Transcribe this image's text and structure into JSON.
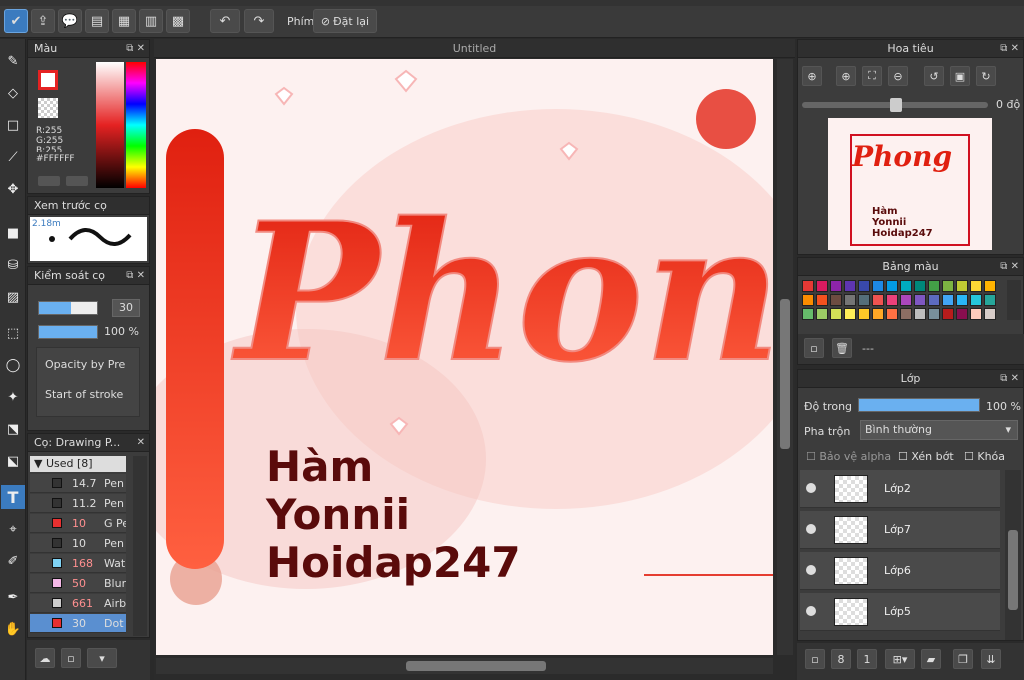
{
  "toolbar": {
    "keys_label": "Phím",
    "reset_label": "Đặt lại"
  },
  "color_panel": {
    "title": "Màu",
    "r": "R:255",
    "g": "G:255",
    "b": "B:255",
    "hex": "#FFFFFF"
  },
  "brush_preview": {
    "title": "Xem trước cọ",
    "size": "2.18m"
  },
  "brush_control": {
    "title": "Kiểm soát cọ",
    "size_value": "30",
    "opacity_value": "100 %",
    "opt1": "Opacity by Pre",
    "opt2": "Start of stroke"
  },
  "brush_list": {
    "title": "Cọ: Drawing P...",
    "group": "Used [8]",
    "items": [
      {
        "size": "14.7",
        "name": "Pen",
        "color": "#333333"
      },
      {
        "size": "11.2",
        "name": "Pen",
        "color": "#333333"
      },
      {
        "size": "10",
        "name": "G Pe",
        "color": "#e83030"
      },
      {
        "size": "10",
        "name": "Pen",
        "color": "#333333"
      },
      {
        "size": "168",
        "name": "Wat",
        "color": "#7fd3f5"
      },
      {
        "size": "50",
        "name": "Blur",
        "color": "#f5b8e8"
      },
      {
        "size": "661",
        "name": "Airb",
        "color": "#cccccc"
      },
      {
        "size": "30",
        "name": "Dot",
        "color": "#e83030"
      }
    ]
  },
  "document": {
    "tab": "Untitled",
    "title_text": "Phong",
    "line1": "Hàm",
    "line2": "Yonnii",
    "line3": "Hoidap247"
  },
  "navigator": {
    "title": "Hoa tiêu",
    "angle": "0 độ"
  },
  "palette": {
    "title": "Bảng màu",
    "label": "---",
    "colors": [
      "#e53935",
      "#d81b60",
      "#8e24aa",
      "#5e35b1",
      "#3949ab",
      "#1e88e5",
      "#039be5",
      "#00acc1",
      "#00897b",
      "#43a047",
      "#7cb342",
      "#c0ca33",
      "#fdd835",
      "#ffb300",
      "#fb8c00",
      "#f4511e",
      "#6d4c41",
      "#757575",
      "#546e7a",
      "#ef5350",
      "#ec407a",
      "#ab47bc",
      "#7e57c2",
      "#5c6bc0",
      "#42a5f5",
      "#29b6f6",
      "#26c6da",
      "#26a69a",
      "#66bb6a",
      "#9ccc65",
      "#d4e157",
      "#ffee58",
      "#ffca28",
      "#ffa726",
      "#ff7043",
      "#8d6e63",
      "#bdbdbd",
      "#78909c",
      "#b71c1c",
      "#880e4f",
      "#ffccbc",
      "#d7ccc8"
    ]
  },
  "layers": {
    "title": "Lớp",
    "opacity_label": "Độ trong",
    "opacity_value": "100 %",
    "blend_label": "Pha trộn",
    "blend_value": "Bình thường",
    "protect_alpha": "Bảo vệ alpha",
    "clipping": "Xén bớt",
    "lock": "Khóa",
    "items": [
      "Lớp2",
      "Lớp7",
      "Lớp6",
      "Lớp5"
    ]
  }
}
